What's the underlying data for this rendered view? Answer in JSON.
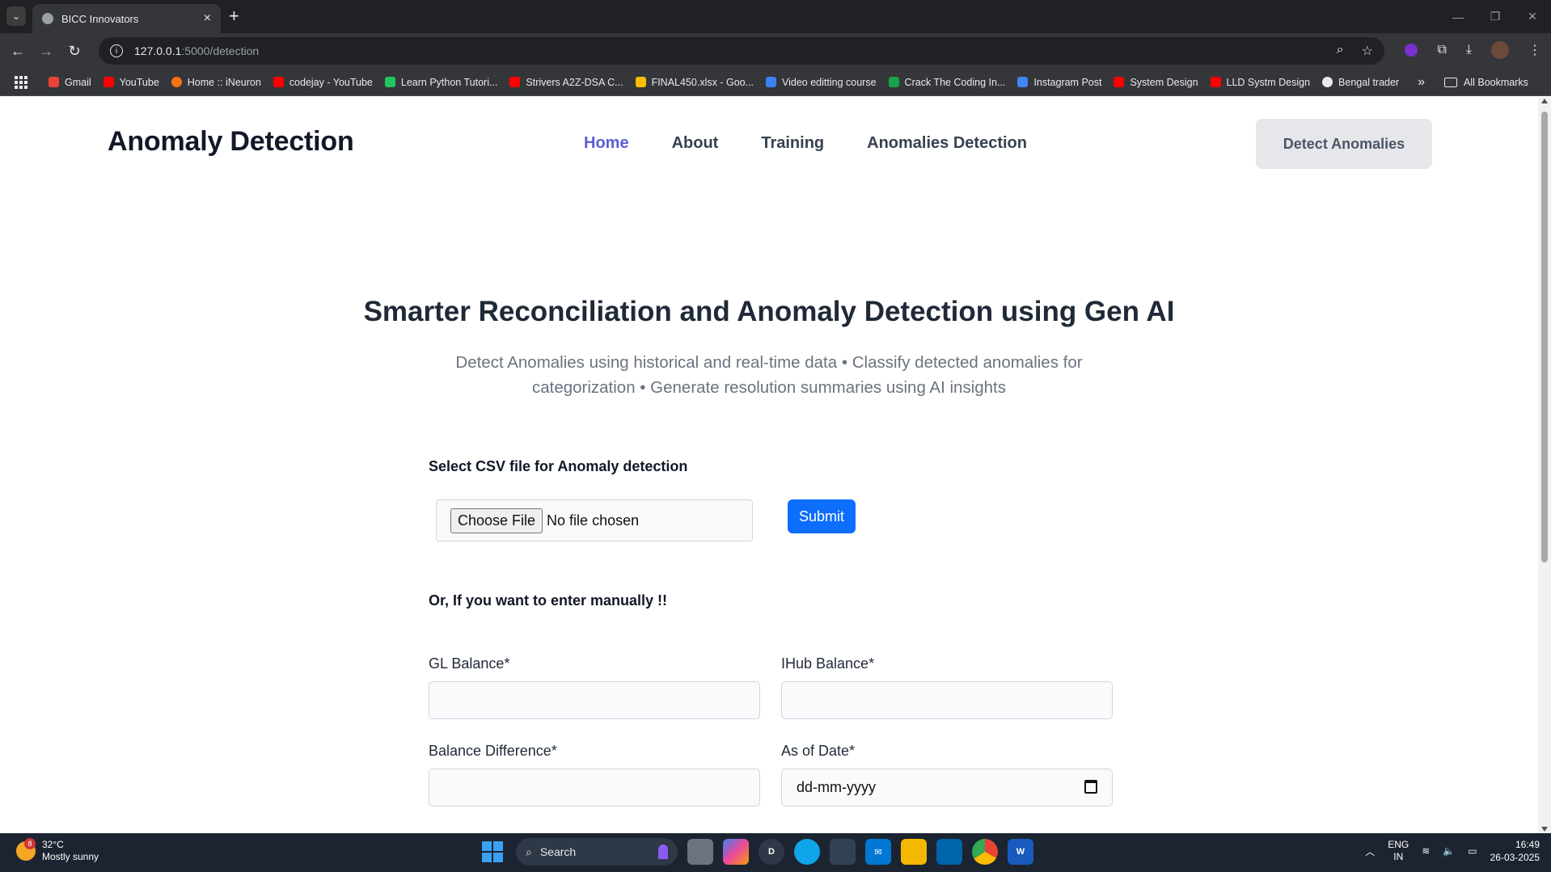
{
  "browser": {
    "tab_title": "BICC Innovators",
    "new_tab_symbol": "+",
    "url_host": "127.0.0.1",
    "url_path": ":5000/detection",
    "bookmarks": [
      {
        "label": "Gmail",
        "color": "#ea4335"
      },
      {
        "label": "YouTube",
        "color": "#ff0000"
      },
      {
        "label": "Home :: iNeuron",
        "color": "#f97316"
      },
      {
        "label": "codejay - YouTube",
        "color": "#ff0000"
      },
      {
        "label": "Learn Python Tutori...",
        "color": "#22c55e"
      },
      {
        "label": "Strivers A2Z-DSA C...",
        "color": "#ff0000"
      },
      {
        "label": "FINAL450.xlsx - Goo...",
        "color": "#fbbc04"
      },
      {
        "label": "Video editting course",
        "color": "#3b82f6"
      },
      {
        "label": "Crack The Coding In...",
        "color": "#16a34a"
      },
      {
        "label": "Instagram Post",
        "color": "#4285f4"
      },
      {
        "label": "System Design",
        "color": "#ff0000"
      },
      {
        "label": "LLD Systm Design",
        "color": "#ff0000"
      },
      {
        "label": "Bengal trader",
        "color": "#e8eaed"
      }
    ],
    "all_bookmarks_label": "All Bookmarks"
  },
  "site": {
    "brand": "Anomaly Detection",
    "nav": [
      {
        "label": "Home",
        "active": true
      },
      {
        "label": "About",
        "active": false
      },
      {
        "label": "Training",
        "active": false
      },
      {
        "label": "Anomalies Detection",
        "active": false
      }
    ],
    "cta_label": "Detect Anomalies",
    "accent_color": "#5b5fd6",
    "submit_color": "#0d6efd"
  },
  "hero": {
    "title": "Smarter Reconciliation and Anomaly Detection using Gen AI",
    "subtitle": "Detect Anomalies using historical and real-time data • Classify detected anomalies for categorization • Generate resolution summaries using AI insights"
  },
  "upload": {
    "label": "Select CSV file for Anomaly detection",
    "choose_button": "Choose File",
    "file_status": "No file chosen",
    "submit_label": "Submit"
  },
  "manual": {
    "heading": "Or, If you want to enter manually !!",
    "fields": {
      "gl_balance": {
        "label": "GL Balance*",
        "value": ""
      },
      "ihub_balance": {
        "label": "IHub Balance*",
        "value": ""
      },
      "balance_difference": {
        "label": "Balance Difference*",
        "value": ""
      },
      "as_of_date": {
        "label": "As of Date*",
        "placeholder": "dd-mm-yyyy"
      }
    }
  },
  "taskbar": {
    "weather_temp": "32°C",
    "weather_desc": "Mostly sunny",
    "weather_badge": "8",
    "search_label": "Search",
    "lang_line1": "ENG",
    "lang_line2": "IN",
    "time": "16:49",
    "date": "26-03-2025"
  }
}
